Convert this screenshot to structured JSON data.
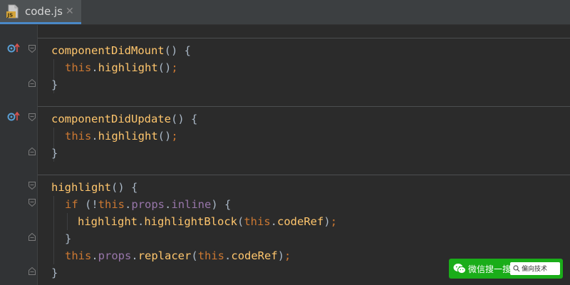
{
  "tab": {
    "label": "code.js",
    "file_icon_text": "JS",
    "close_glyph": "✕"
  },
  "code": {
    "lines": [
      {
        "tokens": [
          {
            "t": "componentDidMount",
            "c": "fn"
          },
          {
            "t": "() {",
            "c": "pl"
          }
        ]
      },
      {
        "tokens": [
          {
            "t": "this",
            "c": "kw"
          },
          {
            "t": ".",
            "c": "pl"
          },
          {
            "t": "highlight",
            "c": "fn"
          },
          {
            "t": "()",
            "c": "pl"
          },
          {
            "t": ";",
            "c": "kw"
          }
        ]
      },
      {
        "tokens": [
          {
            "t": "}",
            "c": "pl"
          }
        ]
      },
      {
        "tokens": [
          {
            "t": "componentDidUpdate",
            "c": "fn"
          },
          {
            "t": "() {",
            "c": "pl"
          }
        ]
      },
      {
        "tokens": [
          {
            "t": "this",
            "c": "kw"
          },
          {
            "t": ".",
            "c": "pl"
          },
          {
            "t": "highlight",
            "c": "fn"
          },
          {
            "t": "()",
            "c": "pl"
          },
          {
            "t": ";",
            "c": "kw"
          }
        ]
      },
      {
        "tokens": [
          {
            "t": "}",
            "c": "pl"
          }
        ]
      },
      {
        "tokens": [
          {
            "t": "highlight",
            "c": "fn"
          },
          {
            "t": "() {",
            "c": "pl"
          }
        ]
      },
      {
        "tokens": [
          {
            "t": "if",
            "c": "kw"
          },
          {
            "t": " (!",
            "c": "pl"
          },
          {
            "t": "this",
            "c": "kw"
          },
          {
            "t": ".",
            "c": "pl"
          },
          {
            "t": "props",
            "c": "prop"
          },
          {
            "t": ".",
            "c": "pl"
          },
          {
            "t": "inline",
            "c": "prop"
          },
          {
            "t": ") {",
            "c": "pl"
          }
        ]
      },
      {
        "tokens": [
          {
            "t": "highlight",
            "c": "fn"
          },
          {
            "t": ".",
            "c": "pl"
          },
          {
            "t": "highlightBlock",
            "c": "fn"
          },
          {
            "t": "(",
            "c": "pl"
          },
          {
            "t": "this",
            "c": "kw"
          },
          {
            "t": ".",
            "c": "pl"
          },
          {
            "t": "codeRef",
            "c": "fn"
          },
          {
            "t": ")",
            "c": "pl"
          },
          {
            "t": ";",
            "c": "kw"
          }
        ]
      },
      {
        "tokens": [
          {
            "t": "}",
            "c": "pl"
          }
        ]
      },
      {
        "tokens": [
          {
            "t": "this",
            "c": "kw"
          },
          {
            "t": ".",
            "c": "pl"
          },
          {
            "t": "props",
            "c": "prop"
          },
          {
            "t": ".",
            "c": "pl"
          },
          {
            "t": "replacer",
            "c": "fn"
          },
          {
            "t": "(",
            "c": "pl"
          },
          {
            "t": "this",
            "c": "kw"
          },
          {
            "t": ".",
            "c": "pl"
          },
          {
            "t": "codeRef",
            "c": "fn"
          },
          {
            "t": ")",
            "c": "pl"
          },
          {
            "t": ";",
            "c": "kw"
          }
        ]
      },
      {
        "tokens": [
          {
            "t": "}",
            "c": "pl"
          }
        ]
      }
    ]
  },
  "gutter_icons": [
    "override-method-icon",
    "override-method-icon"
  ],
  "watermark": {
    "label": "微信搜一搜",
    "search_text": "偏向技术"
  },
  "colors": {
    "background": "#2b2b2b",
    "gutter": "#313335",
    "tab_active": "#4e5254",
    "tab_accent": "#4a88c7",
    "function": "#ffc66d",
    "keyword": "#cc7832",
    "property": "#9876aa",
    "plain": "#a9b7c6",
    "watermark": "#1aad19"
  }
}
